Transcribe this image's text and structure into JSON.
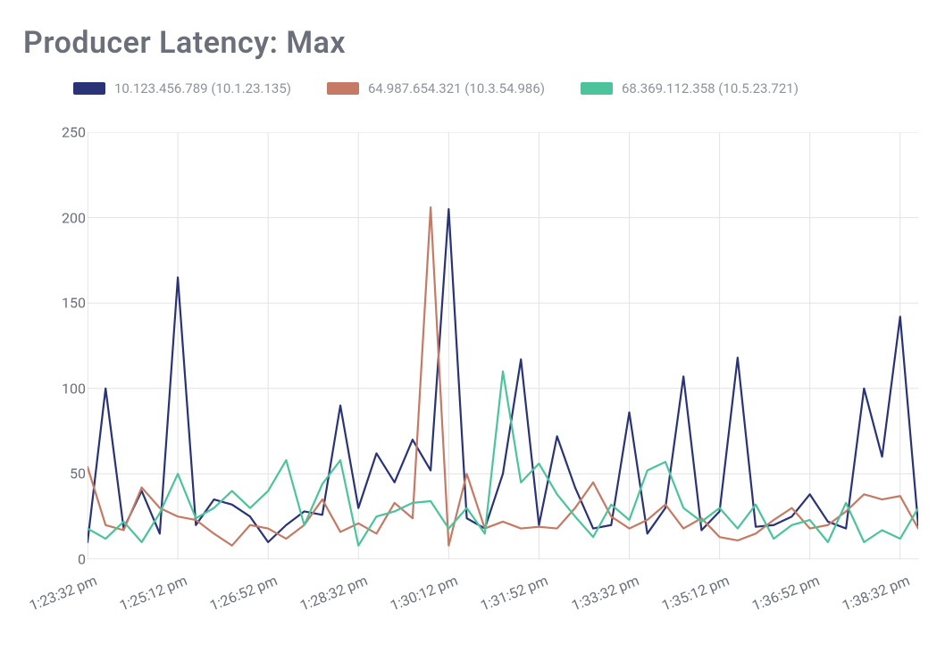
{
  "title": "Producer Latency: Max",
  "colors": {
    "s1": "#2a3375",
    "s2": "#c47a64",
    "s3": "#4dc39b",
    "grid": "#e3e3e3",
    "axis": "#cfd2d8",
    "text": "#6a6f7a"
  },
  "chart_data": {
    "type": "line",
    "title": "Producer Latency: Max",
    "xlabel": "",
    "ylabel": "",
    "ylim": [
      0,
      250
    ],
    "x_tick_labels": [
      "1:23:32 pm",
      "1:25:12 pm",
      "1:26:52 pm",
      "1:28:32 pm",
      "1:30:12 pm",
      "1:31:52 pm",
      "1:33:32 pm",
      "1:35:12 pm",
      "1:36:52 pm",
      "1:38:32 pm"
    ],
    "y_ticks": [
      0,
      50,
      100,
      150,
      200,
      250
    ],
    "x_tick_positions": [
      0,
      5,
      10,
      15,
      20,
      25,
      30,
      35,
      40,
      45
    ],
    "n_points": 47,
    "series": [
      {
        "name": "10.123.456.789 (10.1.23.135)",
        "color_key": "s1",
        "values": [
          10,
          100,
          18,
          40,
          15,
          165,
          20,
          35,
          32,
          25,
          10,
          20,
          28,
          26,
          90,
          30,
          62,
          45,
          70,
          52,
          205,
          24,
          18,
          50,
          117,
          20,
          72,
          42,
          18,
          20,
          86,
          15,
          30,
          107,
          17,
          28,
          118,
          19,
          20,
          25,
          38,
          22,
          18,
          100,
          60,
          142,
          20
        ]
      },
      {
        "name": "64.987.654.321 (10.3.54.986)",
        "color_key": "s2",
        "values": [
          54,
          20,
          17,
          42,
          30,
          25,
          23,
          15,
          8,
          20,
          18,
          12,
          20,
          35,
          16,
          21,
          15,
          33,
          24,
          206,
          8,
          50,
          18,
          22,
          18,
          19,
          18,
          30,
          45,
          25,
          18,
          23,
          32,
          18,
          24,
          13,
          11,
          15,
          23,
          30,
          18,
          20,
          28,
          38,
          35,
          37,
          18
        ]
      },
      {
        "name": "68.369.112.358 (10.5.23.721)",
        "color_key": "s3",
        "values": [
          18,
          12,
          22,
          10,
          27,
          50,
          24,
          30,
          40,
          30,
          40,
          58,
          20,
          44,
          58,
          8,
          25,
          28,
          33,
          34,
          18,
          30,
          15,
          110,
          45,
          56,
          38,
          25,
          13,
          32,
          23,
          52,
          57,
          30,
          22,
          30,
          18,
          32,
          12,
          20,
          23,
          10,
          33,
          10,
          17,
          12,
          30
        ]
      }
    ]
  }
}
